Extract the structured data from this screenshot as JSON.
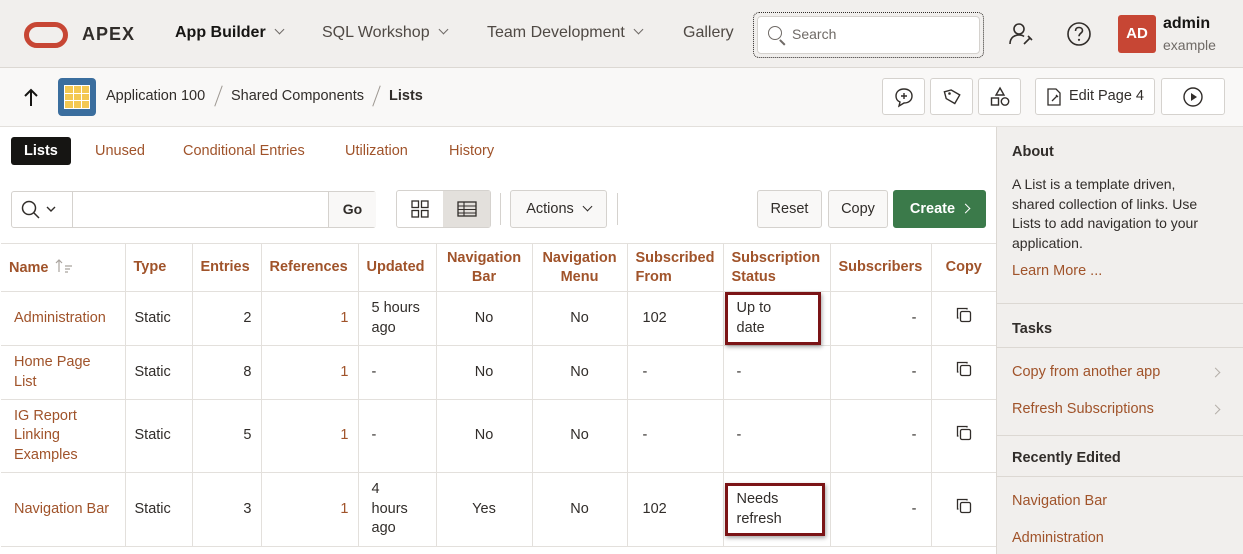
{
  "header": {
    "brand": "APEX",
    "nav": [
      {
        "label": "App Builder",
        "active": true,
        "dropdown": true
      },
      {
        "label": "SQL Workshop",
        "active": false,
        "dropdown": true
      },
      {
        "label": "Team Development",
        "active": false,
        "dropdown": true
      },
      {
        "label": "Gallery",
        "active": false,
        "dropdown": false
      }
    ],
    "search_placeholder": "Search",
    "user": {
      "initials": "AD",
      "name": "admin",
      "workspace": "example"
    },
    "icons": [
      "admin-tools-icon",
      "help-icon"
    ],
    "accent": "#c74634"
  },
  "breadcrumb": {
    "items": [
      "Application 100",
      "Shared Components",
      "Lists"
    ],
    "edit_page_label": "Edit Page 4",
    "toolbar_icons": [
      "feedback-icon",
      "developer-comments-icon",
      "shared-components-icon",
      "edit-page-icon",
      "run-icon"
    ]
  },
  "tabs": [
    "Lists",
    "Unused",
    "Conditional Entries",
    "Utilization",
    "History"
  ],
  "toolbar": {
    "go_label": "Go",
    "actions_label": "Actions",
    "reset_label": "Reset",
    "copy_label": "Copy",
    "create_label": "Create",
    "create_color": "#3b7a4a"
  },
  "table": {
    "columns": [
      "Name",
      "Type",
      "Entries",
      "References",
      "Updated",
      "Navigation Bar",
      "Navigation Menu",
      "Subscribed From",
      "Subscription Status",
      "Subscribers",
      "Copy"
    ],
    "rows": [
      {
        "name": "Administration",
        "type": "Static",
        "entries": "2",
        "references": "1",
        "updated": "5 hours ago",
        "nav_bar": "No",
        "nav_menu": "No",
        "subscribed_from": "102",
        "status": "Up to date",
        "subscribers": "-"
      },
      {
        "name": "Home Page List",
        "type": "Static",
        "entries": "8",
        "references": "1",
        "updated": "-",
        "nav_bar": "No",
        "nav_menu": "No",
        "subscribed_from": "-",
        "status": "-",
        "subscribers": "-"
      },
      {
        "name": "IG Report Linking Examples",
        "type": "Static",
        "entries": "5",
        "references": "1",
        "updated": "-",
        "nav_bar": "No",
        "nav_menu": "No",
        "subscribed_from": "-",
        "status": "-",
        "subscribers": "-"
      },
      {
        "name": "Navigation Bar",
        "type": "Static",
        "entries": "3",
        "references": "1",
        "updated": "4 hours ago",
        "nav_bar": "Yes",
        "nav_menu": "No",
        "subscribed_from": "102",
        "status": "Needs refresh",
        "subscribers": "-"
      }
    ]
  },
  "side_panel": {
    "about_title": "About",
    "about_text": "A List is a template driven, shared collection of links. Use Lists to add navigation to your application.",
    "learn_more": "Learn More ...",
    "tasks_title": "Tasks",
    "tasks": [
      "Copy from another app",
      "Refresh Subscriptions"
    ],
    "recent_title": "Recently Edited",
    "recent": [
      "Navigation Bar",
      "Administration"
    ]
  }
}
